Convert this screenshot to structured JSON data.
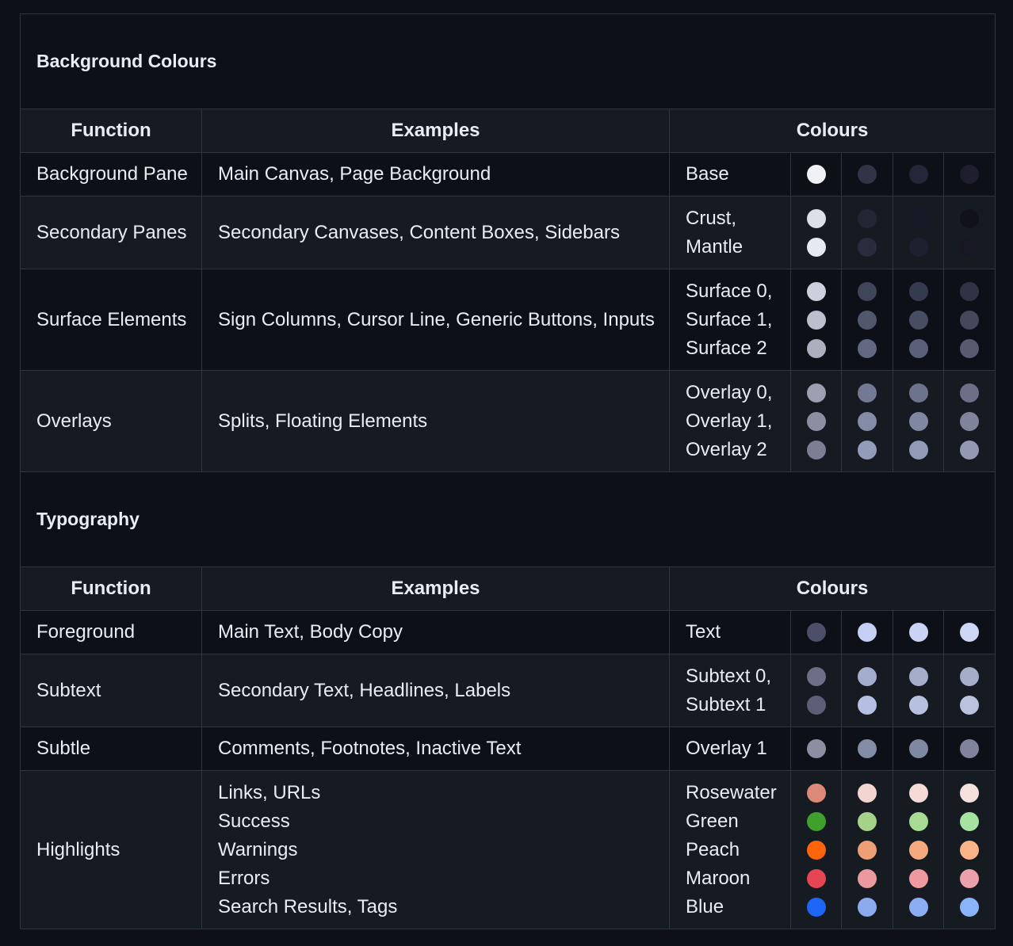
{
  "sections": [
    {
      "title": "Background Colours",
      "headers": {
        "function": "Function",
        "examples": "Examples",
        "colours": "Colours"
      },
      "rows": [
        {
          "function": "Background Pane",
          "examples": [
            "Main Canvas, Page Background"
          ],
          "names": [
            "Base"
          ],
          "swatches": [
            [
              "#eff1f5"
            ],
            [
              "#303446"
            ],
            [
              "#24273a"
            ],
            [
              "#1e1e2e"
            ]
          ]
        },
        {
          "function": "Secondary Panes",
          "examples": [
            "Secondary Canvases, Content Boxes, Sidebars"
          ],
          "names": [
            "Crust,",
            "Mantle"
          ],
          "swatches": [
            [
              "#dce0e8",
              "#e6e9ef"
            ],
            [
              "#232634",
              "#292c3c"
            ],
            [
              "#181926",
              "#1e2030"
            ],
            [
              "#11111b",
              "#181825"
            ]
          ]
        },
        {
          "function": "Surface Elements",
          "examples": [
            "Sign Columns, Cursor Line, Generic Buttons, Inputs"
          ],
          "names": [
            "Surface 0,",
            "Surface 1,",
            "Surface 2"
          ],
          "swatches": [
            [
              "#ccd0da",
              "#bcc0cc",
              "#acb0be"
            ],
            [
              "#414559",
              "#51576d",
              "#626880"
            ],
            [
              "#363a4f",
              "#494d64",
              "#5b6078"
            ],
            [
              "#313244",
              "#45475a",
              "#585b70"
            ]
          ]
        },
        {
          "function": "Overlays",
          "examples": [
            "Splits, Floating Elements"
          ],
          "names": [
            "Overlay 0,",
            "Overlay 1,",
            "Overlay 2"
          ],
          "swatches": [
            [
              "#9ca0b0",
              "#8c8fa1",
              "#7c7f93"
            ],
            [
              "#737994",
              "#838ba7",
              "#949cbb"
            ],
            [
              "#6e738d",
              "#8087a2",
              "#939ab7"
            ],
            [
              "#6c7086",
              "#7f849c",
              "#9399b2"
            ]
          ]
        }
      ]
    },
    {
      "title": "Typography",
      "headers": {
        "function": "Function",
        "examples": "Examples",
        "colours": "Colours"
      },
      "rows": [
        {
          "function": "Foreground",
          "examples": [
            "Main Text, Body Copy"
          ],
          "names": [
            "Text"
          ],
          "swatches": [
            [
              "#4c4f69"
            ],
            [
              "#c6d0f5"
            ],
            [
              "#cad3f5"
            ],
            [
              "#cdd6f4"
            ]
          ]
        },
        {
          "function": "Subtext",
          "examples": [
            "Secondary Text, Headlines, Labels"
          ],
          "names": [
            "Subtext 0,",
            "Subtext 1"
          ],
          "swatches": [
            [
              "#6c6f85",
              "#5c5f77"
            ],
            [
              "#a5adce",
              "#b5bfe2"
            ],
            [
              "#a5adcb",
              "#b8c0e0"
            ],
            [
              "#a6adc8",
              "#bac2de"
            ]
          ]
        },
        {
          "function": "Subtle",
          "examples": [
            "Comments, Footnotes, Inactive Text"
          ],
          "names": [
            "Overlay 1"
          ],
          "swatches": [
            [
              "#8c8fa1"
            ],
            [
              "#838ba7"
            ],
            [
              "#8087a2"
            ],
            [
              "#7f849c"
            ]
          ]
        },
        {
          "function": "Highlights",
          "examples": [
            "Links, URLs",
            "Success",
            "Warnings",
            "Errors",
            "Search Results, Tags"
          ],
          "names": [
            "Rosewater",
            "Green",
            "Peach",
            "Maroon",
            "Blue"
          ],
          "swatches": [
            [
              "#dc8a78",
              "#40a02b",
              "#fe640b",
              "#e64553",
              "#1e66f5"
            ],
            [
              "#f2d5cf",
              "#a6d189",
              "#ef9f76",
              "#ea999c",
              "#8caaee"
            ],
            [
              "#f4dbd6",
              "#a6da95",
              "#f5a97f",
              "#ee99a0",
              "#8aadf4"
            ],
            [
              "#f5e0dc",
              "#a6e3a1",
              "#fab387",
              "#eba0ac",
              "#89b4fa"
            ]
          ]
        }
      ]
    }
  ]
}
